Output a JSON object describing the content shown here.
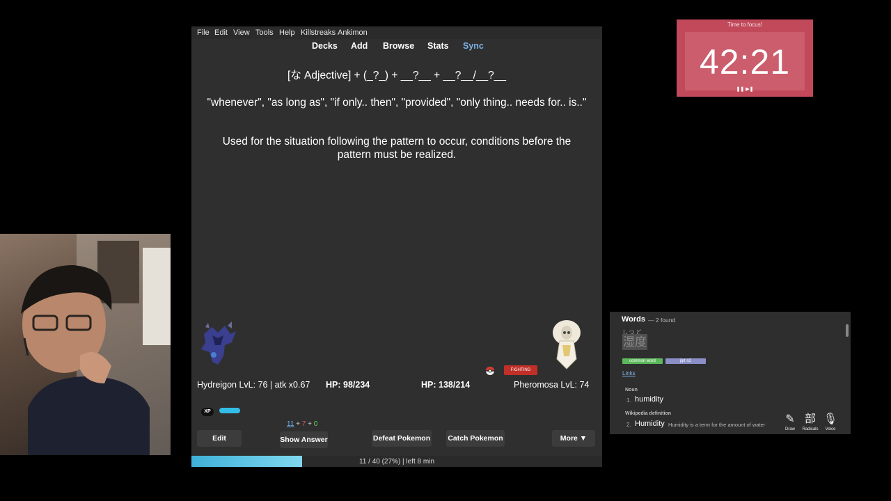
{
  "menu": [
    "File",
    "Edit",
    "View",
    "Tools",
    "Help",
    "Killstreaks",
    "Ankimon"
  ],
  "toplinks": [
    "Decks",
    "Add",
    "Browse",
    "Stats",
    "Sync"
  ],
  "card": {
    "front": "[な Adjective] + (_?_) + __?__ + __?__/__?__",
    "meanings": "\"whenever\", \"as long as\", \"if only.. then\", \"provided\", \"only thing.. needs for.. is..\"",
    "usage": "Used for the situation following the pattern to occur, conditions before the pattern must be realized."
  },
  "battle": {
    "player": "Hydreigon LvL: 76 | atk x0.67",
    "player_hp": "HP: 98/234",
    "enemy_hp": "HP: 138/214",
    "enemy": "Pheromosa LvL: 74",
    "enemy_type": "FIGHTING",
    "xp_label": "XP",
    "xp_fraction": 0.3
  },
  "counts": {
    "new": "11",
    "learn": "7",
    "review": "0",
    "plus": "+"
  },
  "buttons": {
    "edit": "Edit",
    "show_answer": "Show Answer",
    "defeat": "Defeat Pokemon",
    "catch": "Catch Pokemon",
    "more": "More ▼"
  },
  "progress": {
    "text": "11 / 40 (27%) | left 8 min",
    "fraction": 0.27
  },
  "timer": {
    "title": "Time to focus!",
    "time": "42:21",
    "controls": "❚❚ ▶❚"
  },
  "dictionary": {
    "title": "Words",
    "found": "— 2 found",
    "reading": "しつど",
    "kanji": "湿度",
    "tags": [
      "common word",
      "jlpt n2"
    ],
    "links": "Links",
    "pos": "Noun",
    "def1_num": "1.",
    "def1": "humidity",
    "wiki_label": "Wikipedia definition",
    "def2_num": "2.",
    "def2": "Humidity",
    "def2_desc": "Humidity is a term for the amount of water",
    "tools": [
      {
        "icon": "✎",
        "label": "Draw"
      },
      {
        "icon": "部",
        "label": "Radicals"
      },
      {
        "icon": "🎙",
        "label": "Voice"
      }
    ]
  },
  "colors": {
    "timer_bg": "#c1495a",
    "type_fighting": "#c03028",
    "tag_common": "#5cb85c",
    "tag_jlpt": "#8a8fc7",
    "link": "#7eb2e6",
    "xp": "#33bde6"
  }
}
